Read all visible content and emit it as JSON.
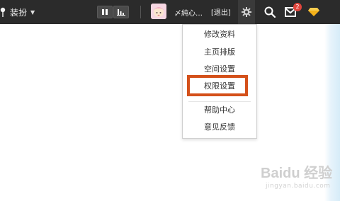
{
  "topbar": {
    "dress_label": "装扮",
    "username": "〆純心…",
    "logout_label": "[退出]",
    "mail_badge": "2"
  },
  "dropdown": {
    "items": [
      {
        "label": "修改资料"
      },
      {
        "label": "主页排版"
      },
      {
        "label": "空间设置"
      },
      {
        "label": "权限设置",
        "highlighted": true
      },
      {
        "label": "帮助中心"
      },
      {
        "label": "意见反馈"
      }
    ]
  },
  "watermark": {
    "logo_text": "Baidu 经验",
    "url": "jingyan.baidu.com"
  },
  "colors": {
    "topbar": "#2b2b2b",
    "highlight_border": "#d4501a",
    "badge": "#e0453c",
    "vip_diamond": "#f5b21a"
  },
  "icons": [
    "pin-icon",
    "caret-down-icon",
    "pause-icon",
    "bar-chart-icon",
    "gear-icon",
    "search-icon",
    "mail-icon",
    "diamond-icon"
  ]
}
